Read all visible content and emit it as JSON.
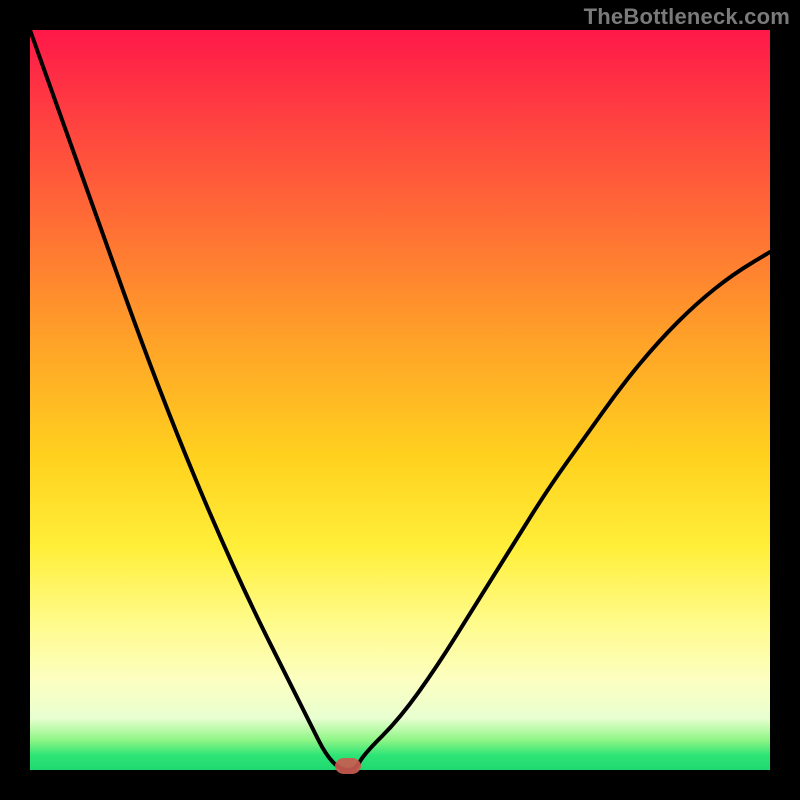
{
  "watermark": "TheBottleneck.com",
  "colors": {
    "curve_stroke": "#000000",
    "marker_fill": "#c85a4f"
  },
  "chart_data": {
    "type": "line",
    "title": "",
    "xlabel": "",
    "ylabel": "",
    "xlim": [
      0,
      100
    ],
    "ylim": [
      0,
      100
    ],
    "grid": false,
    "series": [
      {
        "name": "bottleneck-curve",
        "x": [
          0,
          5,
          10,
          15,
          20,
          25,
          30,
          35,
          38,
          40,
          42,
          44,
          45,
          50,
          55,
          60,
          65,
          70,
          75,
          80,
          85,
          90,
          95,
          100
        ],
        "y": [
          100,
          86,
          72,
          58,
          45,
          33,
          22,
          12,
          6,
          2,
          0,
          0,
          2,
          7,
          14,
          22,
          30,
          38,
          45,
          52,
          58,
          63,
          67,
          70
        ]
      }
    ],
    "marker": {
      "x": 43,
      "y": 0.5
    },
    "background_gradient": {
      "orientation": "vertical",
      "stops": [
        {
          "at": 0,
          "color": "#ff1849"
        },
        {
          "at": 25,
          "color": "#ff6a36"
        },
        {
          "at": 58,
          "color": "#ffd21e"
        },
        {
          "at": 88,
          "color": "#fcffc2"
        },
        {
          "at": 100,
          "color": "#1fd970"
        }
      ]
    }
  }
}
